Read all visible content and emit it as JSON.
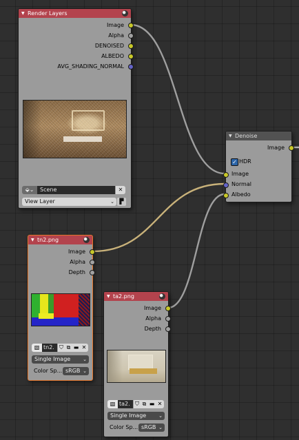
{
  "colors": {
    "image_socket": "#c8c829",
    "vector_socket": "#6363c7",
    "float_socket": "#a1a1a1",
    "node_header_red": "#b3434d",
    "node_body": "#9b9b9b",
    "selection_outline": "#e3762c"
  },
  "render_layers": {
    "title": "Render Layers",
    "outputs": [
      "Image",
      "Alpha",
      "DENOISED",
      "ALBEDO",
      "AVG_SHADING_NORMAL"
    ],
    "scene": "Scene",
    "view_layer": "View Layer",
    "close_glyph": "✕"
  },
  "denoise": {
    "title": "Denoise",
    "output": "Image",
    "hdr_label": "HDR",
    "hdr_checked": true,
    "inputs": [
      "Image",
      "Normal",
      "Albedo"
    ]
  },
  "tn2": {
    "title": "tn2.png",
    "outputs": [
      "Image",
      "Alpha",
      "Depth"
    ],
    "image_name": "tn2.",
    "source": "Single Image",
    "color_space_label": "Color Sp...",
    "color_space": "sRGB",
    "close_glyph": "✕"
  },
  "ta2": {
    "title": "ta2.png",
    "outputs": [
      "Image",
      "Alpha",
      "Depth"
    ],
    "image_name": "ta2.",
    "source": "Single Image",
    "color_space_label": "Color Sp...",
    "color_space": "sRGB",
    "close_glyph": "✕"
  }
}
